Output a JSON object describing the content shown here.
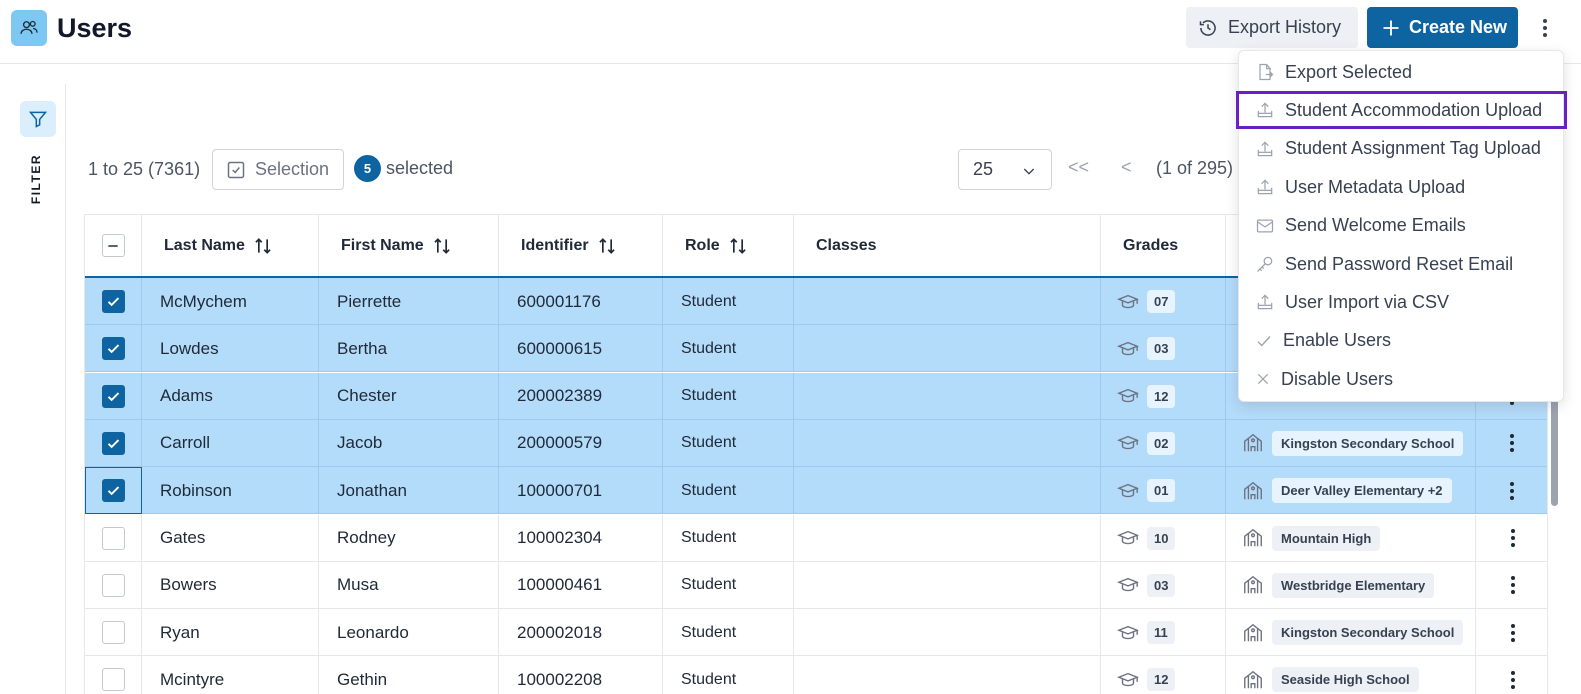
{
  "header": {
    "title": "Users",
    "export_history_label": "Export History",
    "create_new_label": "Create New"
  },
  "filter": {
    "label": "FILTER"
  },
  "toolbar": {
    "range_text": "1 to 25 (7361)",
    "selection_label": "Selection",
    "selected_count": "5",
    "selected_label": "selected",
    "page_size": "25",
    "page_first": "<<",
    "page_prev": "<",
    "page_info": "(1 of 295)"
  },
  "columns": {
    "last_name": "Last Name",
    "first_name": "First Name",
    "identifier": "Identifier",
    "role": "Role",
    "classes": "Classes",
    "grades": "Grades"
  },
  "rows": [
    {
      "last": "McMychem",
      "first": "Pierrette",
      "id": "600001176",
      "role": "Student",
      "grade": "07",
      "school": "",
      "selected": true
    },
    {
      "last": "Lowdes",
      "first": "Bertha",
      "id": "600000615",
      "role": "Student",
      "grade": "03",
      "school": "",
      "selected": true
    },
    {
      "last": "Adams",
      "first": "Chester",
      "id": "200002389",
      "role": "Student",
      "grade": "12",
      "school": "",
      "selected": true
    },
    {
      "last": "Carroll",
      "first": "Jacob",
      "id": "200000579",
      "role": "Student",
      "grade": "02",
      "school": "Kingston Secondary School",
      "selected": true
    },
    {
      "last": "Robinson",
      "first": "Jonathan",
      "id": "100000701",
      "role": "Student",
      "grade": "01",
      "school": "Deer Valley Elementary +2",
      "selected": true
    },
    {
      "last": "Gates",
      "first": "Rodney",
      "id": "100002304",
      "role": "Student",
      "grade": "10",
      "school": "Mountain High",
      "selected": false
    },
    {
      "last": "Bowers",
      "first": "Musa",
      "id": "100000461",
      "role": "Student",
      "grade": "03",
      "school": "Westbridge Elementary",
      "selected": false
    },
    {
      "last": "Ryan",
      "first": "Leonardo",
      "id": "200002018",
      "role": "Student",
      "grade": "11",
      "school": "Kingston Secondary School",
      "selected": false
    },
    {
      "last": "Mcintyre",
      "first": "Gethin",
      "id": "100002208",
      "role": "Student",
      "grade": "12",
      "school": "Seaside High School",
      "selected": false
    }
  ],
  "menu": {
    "items": [
      {
        "label": "Export Selected",
        "icon": "file-export-icon"
      },
      {
        "label": "Student Accommodation Upload",
        "icon": "upload-icon"
      },
      {
        "label": "Student Assignment Tag Upload",
        "icon": "upload-icon"
      },
      {
        "label": "User Metadata Upload",
        "icon": "upload-icon"
      },
      {
        "label": "Send Welcome Emails",
        "icon": "mail-icon"
      },
      {
        "label": "Send Password Reset Email",
        "icon": "key-icon"
      },
      {
        "label": "User Import via CSV",
        "icon": "upload-icon"
      },
      {
        "label": "Enable Users",
        "icon": "check-icon"
      },
      {
        "label": "Disable Users",
        "icon": "x-icon"
      }
    ]
  },
  "colors": {
    "primary": "#0e64a0",
    "selected_row": "#b3dbfa",
    "highlight_border": "#6a1fc2",
    "app_icon_bg": "#7dc8f3"
  }
}
